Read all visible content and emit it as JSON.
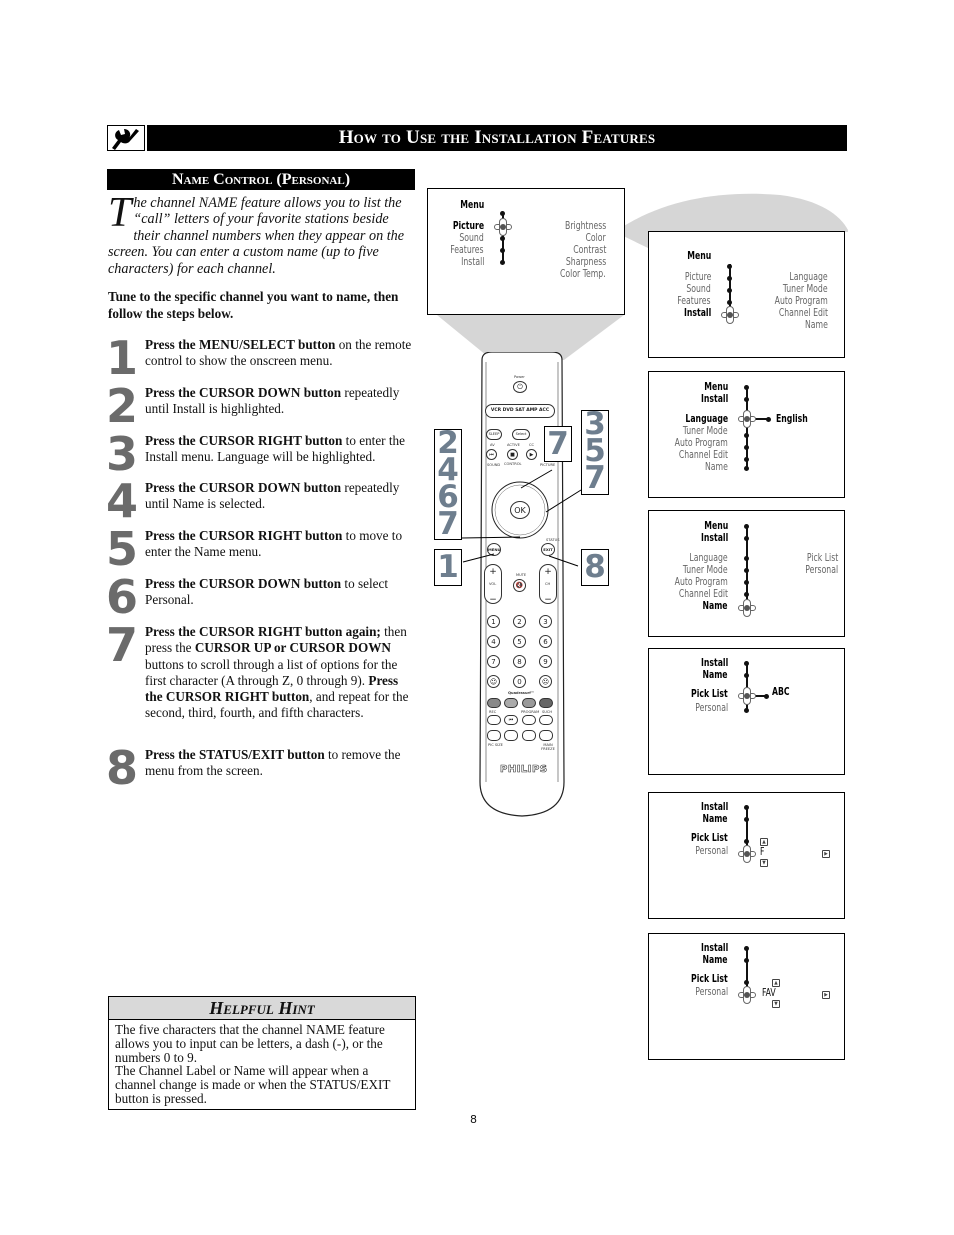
{
  "header": {
    "icon": "wrench-icon",
    "title": "How to Use the Installation Features"
  },
  "section": {
    "title": "Name Control (Personal)"
  },
  "intro": {
    "dropcap": "T",
    "text": "he channel NAME feature allows you to list the “call” letters of your favorite stations beside their channel numbers when they appear on the screen.  You can  enter a custom name (up to five characters) for each channel."
  },
  "tune_instruction": "Tune to the specific channel you want to name, then follow the steps below.",
  "steps": [
    {
      "num": "1",
      "bold": "Press the MENU/SELECT button",
      "rest": " on the remote control to show the onscreen menu."
    },
    {
      "num": "2",
      "bold": "Press the CURSOR DOWN button",
      "rest": " repeatedly until Install is highlighted."
    },
    {
      "num": "3",
      "bold": "Press the CURSOR RIGHT button",
      "rest": " to enter the Install menu. Language will be highlighted."
    },
    {
      "num": "4",
      "bold": "Press the CURSOR DOWN button",
      "rest": " repeatedly until Name is selected."
    },
    {
      "num": "5",
      "bold": "Press the CURSOR RIGHT button",
      "rest": " to move to enter the Name menu."
    },
    {
      "num": "6",
      "bold": "Press the CURSOR DOWN button",
      "rest": " to select Personal."
    },
    {
      "num": "7",
      "bold": "Press the CURSOR RIGHT button again;",
      "rest_a": " then press the ",
      "bold2": "CURSOR UP or CURSOR DOWN",
      "rest_b": " buttons to scroll through a list of options for the first character (A through Z, 0 through 9).  ",
      "bold3": "Press the CURSOR RIGHT button",
      "rest_c": ", and repeat for the second, third, fourth, and fifth characters."
    },
    {
      "num": "8",
      "bold": "Press the STATUS/EXIT button",
      "rest": " to remove the menu from the screen."
    }
  ],
  "hint": {
    "title": "Helpful Hint",
    "line1": "The five characters that the channel NAME feature allows you to input can be letters, a dash (-), or the numbers 0 to 9.",
    "line2": "The Channel Label or Name will appear when a channel change is made or when the STATUS/EXIT button is pressed."
  },
  "page_number": "8",
  "screens": {
    "s0": {
      "header": "Menu",
      "items": [
        "Picture",
        "Sound",
        "Features",
        "Install"
      ],
      "selected": "Picture",
      "submenu": [
        "Brightness",
        "Color",
        "Contrast",
        "Sharpness",
        "Color Temp."
      ]
    },
    "s1": {
      "header": "Menu",
      "items": [
        "Picture",
        "Sound",
        "Features",
        "Install"
      ],
      "selected": "Install",
      "submenu": [
        "Language",
        "Tuner Mode",
        "Auto Program",
        "Channel Edit",
        "Name"
      ]
    },
    "s2": {
      "path": [
        "Menu",
        "Install"
      ],
      "items": [
        "Language",
        "Tuner Mode",
        "Auto Program",
        "Channel Edit",
        "Name"
      ],
      "selected": "Language",
      "value": "English"
    },
    "s3": {
      "path": [
        "Menu",
        "Install"
      ],
      "items": [
        "Language",
        "Tuner Mode",
        "Auto Program",
        "Channel Edit",
        "Name"
      ],
      "selected": "Name",
      "submenu": [
        "Pick List",
        "Personal"
      ]
    },
    "s4": {
      "path": [
        "Install",
        "Name"
      ],
      "items": [
        "Pick List",
        "Personal"
      ],
      "selected": "Pick List",
      "value": "ABC"
    },
    "s5": {
      "path": [
        "Install",
        "Name"
      ],
      "items": [
        "Pick List",
        "Personal"
      ],
      "selected": "Personal",
      "value": "F"
    },
    "s6": {
      "path": [
        "Install",
        "Name"
      ],
      "items": [
        "Pick List",
        "Personal"
      ],
      "selected": "Personal",
      "value": "FAV"
    }
  },
  "callouts": {
    "left_top": [
      "2",
      "4",
      "6",
      "7"
    ],
    "left_bottom": "1",
    "center": "7",
    "right_top": [
      "3",
      "5",
      "7"
    ],
    "right_bottom": "8"
  },
  "remote": {
    "power_label": "Power",
    "source_row": "VCR DVD SAT AMP ACC",
    "sleep": "SLEEP",
    "select": "Select",
    "labels_row1": [
      "AV",
      "ACTIVE",
      "CC"
    ],
    "control": "CONTROL",
    "sound": "SOUND",
    "picture": "PICTURE",
    "ok": "OK",
    "menu": "MENU",
    "status": "STATUS",
    "exit": "EXIT",
    "vol": "VOL",
    "ch": "CH",
    "mute": "MUTE",
    "digits": [
      "1",
      "2",
      "3",
      "4",
      "5",
      "6",
      "7",
      "8",
      "9"
    ],
    "zero": "0",
    "quadrasurf": "Quadrasurf™",
    "labels_row2": [
      "REC",
      "PROGRAM",
      "SUCH"
    ],
    "bottom_labels": [
      "PIC SIZE",
      "MAIN FREEZE"
    ],
    "brand": "PHILIPS"
  }
}
